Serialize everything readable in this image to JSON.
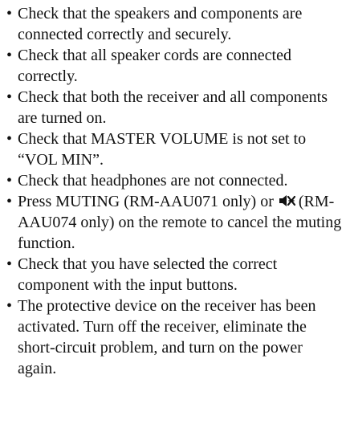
{
  "items": [
    {
      "bullet": "•",
      "text": "Check that the speakers and components are connected correctly and securely."
    },
    {
      "bullet": "•",
      "text": "Check that all speaker cords are connected correctly."
    },
    {
      "bullet": "•",
      "text": "Check that both the receiver and all components are turned on."
    },
    {
      "bullet": "•",
      "text": "Check that MASTER VOLUME is not set to “VOL MIN”."
    },
    {
      "bullet": "•",
      "text": "Check that headphones are not connected."
    },
    {
      "bullet": "•",
      "text_before_icon": "Press MUTING (RM-AAU071 only) or",
      "icon": "mute-icon",
      "text_after_icon": "(RM-AAU074 only) on the remote to cancel the muting function."
    },
    {
      "bullet": "•",
      "text": "Check that you have selected the correct component with the input buttons."
    },
    {
      "bullet": "•",
      "text": "The protective device on the receiver has been activated. Turn off the receiver, eliminate the short-circuit problem, and turn on the power again."
    }
  ]
}
